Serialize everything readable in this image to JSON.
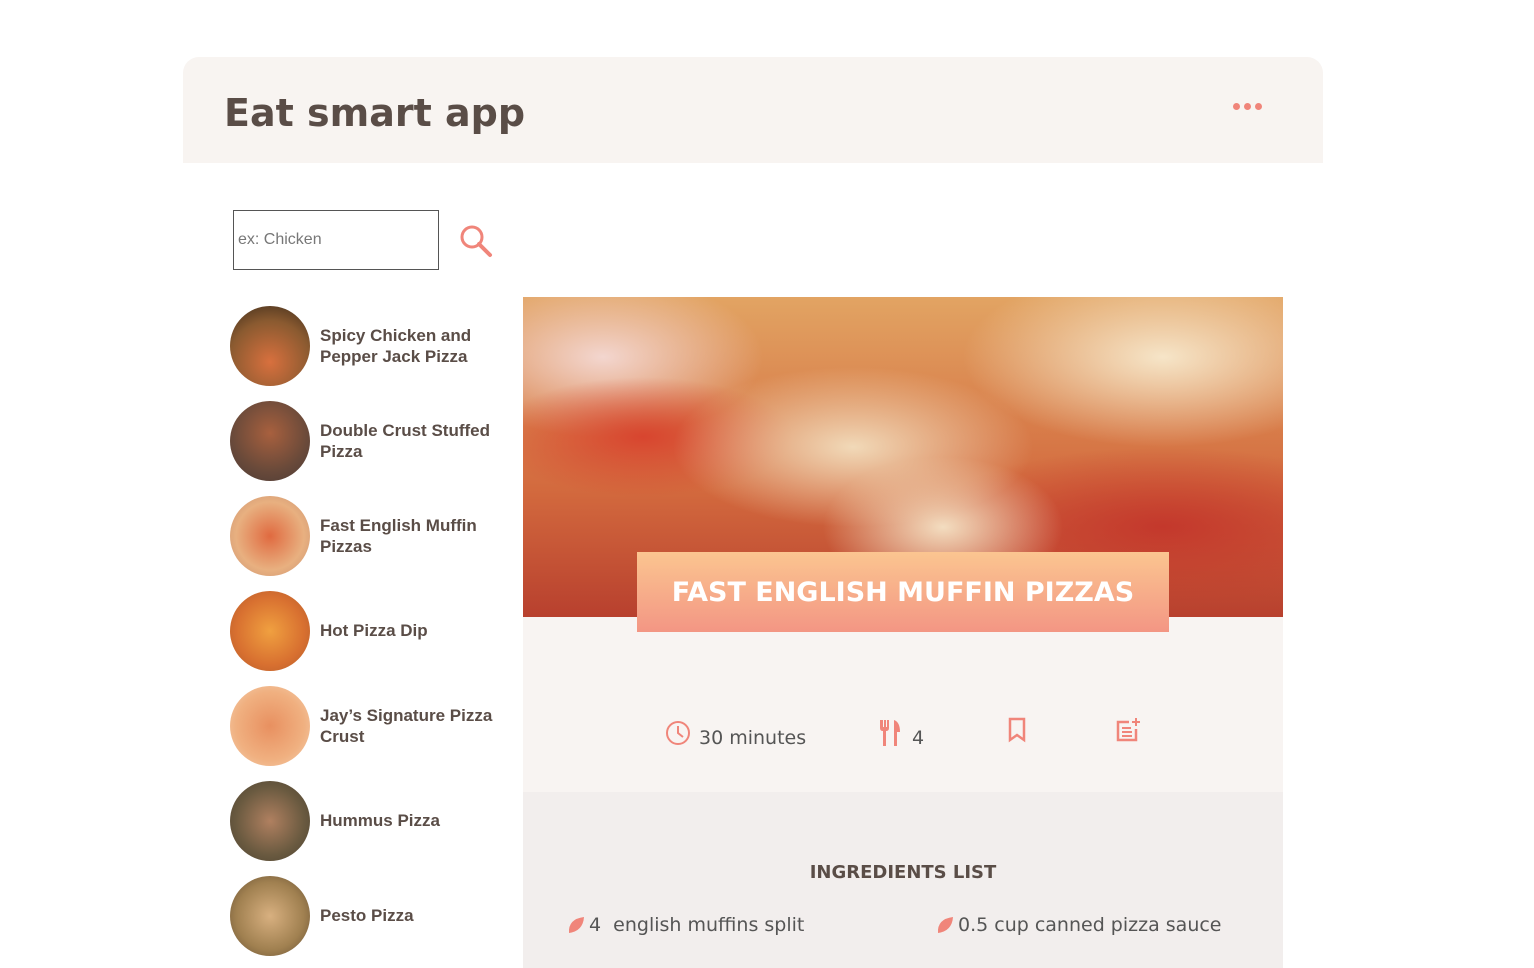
{
  "app": {
    "title": "Eat smart app",
    "menu_icon": "more-horizontal-icon"
  },
  "search": {
    "placeholder": "ex: Chicken",
    "value": "",
    "icon": "search-icon"
  },
  "recipes": [
    {
      "name": "Spicy Chicken and Pepper Jack Pizza"
    },
    {
      "name": "Double Crust Stuffed Pizza"
    },
    {
      "name": "Fast English Muffin Pizzas"
    },
    {
      "name": "Hot Pizza Dip"
    },
    {
      "name": "Jay’s Signature Pizza Crust"
    },
    {
      "name": "Hummus Pizza"
    },
    {
      "name": "Pesto Pizza"
    }
  ],
  "detail": {
    "title": "FAST ENGLISH MUFFIN PIZZAS",
    "time": "30 minutes",
    "servings": "4",
    "ingredients_title": "INGREDIENTS LIST",
    "ingredients": [
      "4  english muffins split",
      "0.5 cup canned pizza sauce"
    ]
  },
  "colors": {
    "accent": "#f0857a",
    "text": "#5a4d47"
  }
}
